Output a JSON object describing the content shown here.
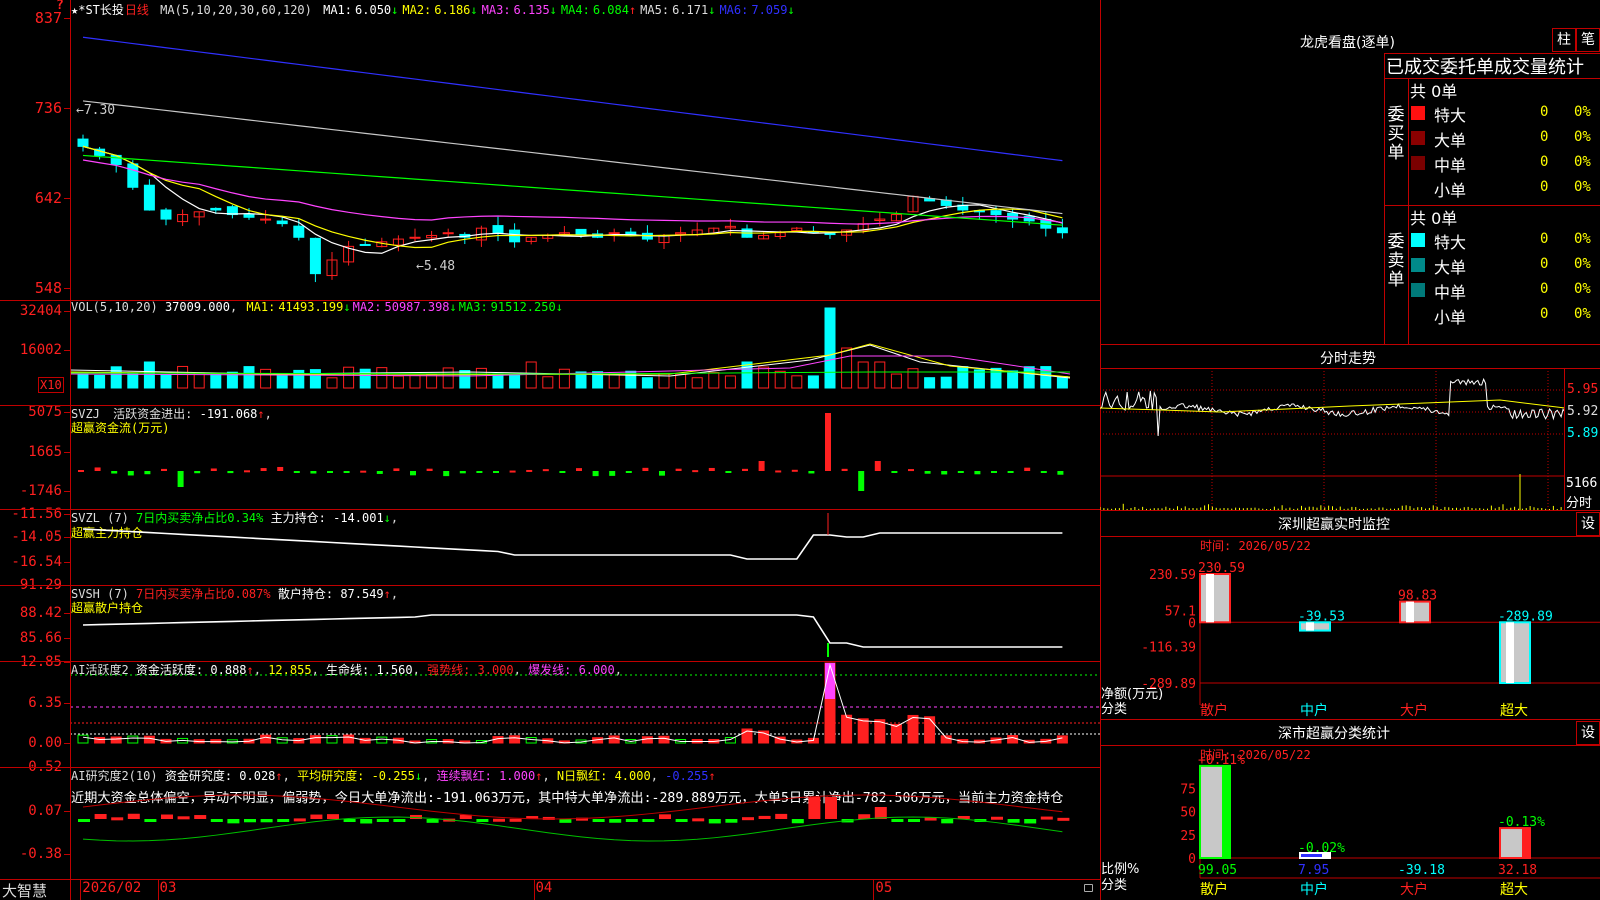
{
  "colors": {
    "up": "#ff2020",
    "down": "#00ffff",
    "border": "#c00000",
    "white": "#ffffff",
    "yellow": "#ffff00",
    "magenta": "#ff44ff",
    "green": "#00ff00",
    "blue": "#3030ff",
    "grey": "#c8c8c8"
  },
  "main": {
    "corner_mark": "?",
    "title_stock": "★*ST长投",
    "title_period": "日线",
    "ma_def": "MA(5,10,20,30,60,120)",
    "ma": [
      {
        "label": "MA1:",
        "value": "6.050",
        "arrow": "↓",
        "color": "#ffffff",
        "acolor": "#00ff00"
      },
      {
        "label": "MA2:",
        "value": "6.186",
        "arrow": "↓",
        "color": "#ffff00",
        "acolor": "#00ff00"
      },
      {
        "label": "MA3:",
        "value": "6.135",
        "arrow": "↓",
        "color": "#ff44ff",
        "acolor": "#00ff00"
      },
      {
        "label": "MA4:",
        "value": "6.084",
        "arrow": "↑",
        "color": "#00ff00",
        "acolor": "#ff2020"
      },
      {
        "label": "MA5:",
        "value": "6.171",
        "arrow": "↓",
        "color": "#dddddd",
        "acolor": "#00ff00"
      },
      {
        "label": "MA6:",
        "value": "7.059",
        "arrow": "↓",
        "color": "#3030ff",
        "acolor": "#00ff00"
      }
    ],
    "y_ticks": [
      {
        "v": "837",
        "p": 0.06
      },
      {
        "v": "736",
        "p": 0.36
      },
      {
        "v": "642",
        "p": 0.66
      },
      {
        "v": "548",
        "p": 0.96
      }
    ],
    "high_mark": "←7.30",
    "low_mark": "←5.48"
  },
  "vol": {
    "header_def": "VOL(5,10,20)",
    "header_value": "37009.000",
    "ma": [
      {
        "label": "MA1:",
        "value": "41493.199",
        "arrow": "↓",
        "color": "#ffff00"
      },
      {
        "label": "MA2:",
        "value": "50987.398",
        "arrow": "↓",
        "color": "#ff44ff"
      },
      {
        "label": "MA3:",
        "value": "91512.250",
        "arrow": "↓",
        "color": "#00ff00"
      }
    ],
    "y_ticks": [
      "32404",
      "16002"
    ],
    "unit": "X10"
  },
  "svzj": {
    "name": "SVZJ",
    "label1": "活跃资金进出:",
    "value1": "-191.068",
    "arrow1": "↑",
    "line2": "超赢资金流(万元)",
    "y_ticks": [
      "5075",
      "1665",
      "-1746"
    ]
  },
  "svzl": {
    "name": "SVZL (7)",
    "label1": "7日内买卖净占比0.34%",
    "label2": "主力持仓:",
    "value2": "-14.001",
    "arrow2": "↓",
    "line2": "超赢主力持仓",
    "y_ticks": [
      "-11.56",
      "-14.05",
      "-16.54"
    ]
  },
  "svsh": {
    "name": "SVSH (7)",
    "label1": "7日内买卖净占比0.087%",
    "label2": "散户持仓:",
    "value2": "87.549",
    "arrow2": "↑",
    "line2": "超赢散户持仓",
    "y_ticks": [
      "91.29",
      "88.42",
      "85.66"
    ]
  },
  "ai1": {
    "name": "AI活跃度2",
    "l1": "资金活跃度:",
    "v1": "0.888",
    "a1": "↑",
    "v1b": "12.855",
    "l2": "生命线:",
    "v2": "1.560",
    "l3": "强势线:",
    "v3": "3.000",
    "l4": "爆发线:",
    "v4": "6.000",
    "y_ticks": [
      "12.85",
      "6.35",
      "0.00"
    ]
  },
  "ai2": {
    "name": "AI研究度2(10)",
    "l1": "资金研究度:",
    "v1": "0.028",
    "a1": "↑",
    "l2": "平均研究度:",
    "v2": "-0.255",
    "a2": "↓",
    "l3": "连续飘红:",
    "v3": "1.000",
    "a3": "↑",
    "l4": "N日飘红:",
    "v4": "4.000",
    "v5": "-0.255",
    "a5": "↑",
    "desc": "近期大资金总体偏空，异动不明显，偏弱势，今日大单净流出:-191.063万元，其中特大单净流出:-289.889万元，大单5日累计净出-782.506万元，当前主力资金持仓",
    "y_ticks": [
      "0.52",
      "0.07",
      "-0.38"
    ]
  },
  "xaxis": {
    "app": "大智慧",
    "labels": [
      {
        "t": "2026/02",
        "p": 0.01
      },
      {
        "t": "03",
        "p": 0.085
      },
      {
        "t": "04",
        "p": 0.45
      },
      {
        "t": "05",
        "p": 0.78
      }
    ]
  },
  "lhb": {
    "title": "龙虎看盘(逐单)",
    "btn1": "柱",
    "btn2": "笔",
    "subtitle": "已成交委托单成交量统计",
    "buy": {
      "side": "委买单",
      "total": "共 0单",
      "rows": [
        {
          "n": "特大",
          "c": "#ff1010",
          "v": "0",
          "p": "0%"
        },
        {
          "n": "大单",
          "c": "#8a0000",
          "v": "0",
          "p": "0%"
        },
        {
          "n": "中单",
          "c": "#7a0000",
          "v": "0",
          "p": "0%"
        },
        {
          "n": "小单",
          "c": "",
          "v": "0",
          "p": "0%"
        }
      ]
    },
    "sell": {
      "side": "委卖单",
      "total": "共 0单",
      "rows": [
        {
          "n": "特大",
          "c": "#00ffff",
          "v": "0",
          "p": "0%"
        },
        {
          "n": "大单",
          "c": "#008a8a",
          "v": "0",
          "p": "0%"
        },
        {
          "n": "中单",
          "c": "#007a7a",
          "v": "0",
          "p": "0%"
        },
        {
          "n": "小单",
          "c": "",
          "v": "0",
          "p": "0%"
        }
      ]
    }
  },
  "intraday": {
    "title": "分时走势",
    "prices": [
      "5.95",
      "5.92",
      "5.89"
    ],
    "vol": "5166",
    "vol_unit": "分时"
  },
  "monitor": {
    "title": "深圳超赢实时监控",
    "btn": "设",
    "time": "时间: 2026/05/22",
    "y_ticks": [
      "230.59",
      "57.1",
      "0",
      "-116.39",
      "-289.89"
    ],
    "y_label1": "净额(万元)",
    "y_label2": "分类",
    "cats": [
      "散户",
      "中户",
      "大户",
      "超大"
    ],
    "values": [
      {
        "c": "散户",
        "v": 230.59,
        "l": "230.59"
      },
      {
        "c": "中户",
        "v": -39.53,
        "l": "-39.53"
      },
      {
        "c": "大户",
        "v": 98.83,
        "l": "98.83"
      },
      {
        "c": "超大",
        "v": -289.89,
        "l": "-289.89"
      }
    ]
  },
  "stats": {
    "title": "深市超赢分类统计",
    "btn": "设",
    "time": "时间: 2026/05/22",
    "y_ticks": [
      "75",
      "50",
      "25",
      "0"
    ],
    "y_label1": "比例%",
    "y_label2": "分类",
    "cats": [
      "散户",
      "中户",
      "大户",
      "超大"
    ],
    "top_labels": [
      "+0.11%",
      "-0.02%",
      "",
      "-0.13%"
    ],
    "bottom_values": [
      "99.05",
      "7.95",
      "-39.18",
      "32.18"
    ],
    "pcts": [
      99.05,
      7.95,
      0,
      32.18
    ]
  }
}
